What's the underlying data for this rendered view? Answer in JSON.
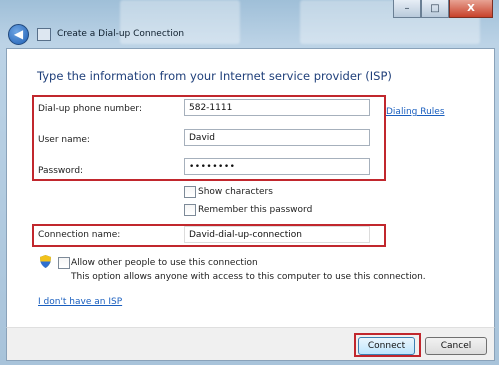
{
  "window": {
    "title": "Create a Dial-up Connection",
    "controls": {
      "minimize": "–",
      "maximize": "□",
      "close": "X"
    }
  },
  "page": {
    "heading": "Type the information from your Internet service provider (ISP)",
    "phone": {
      "label": "Dial-up phone number:",
      "value": "582-1111"
    },
    "dialing_rules": "Dialing Rules",
    "username": {
      "label": "User name:",
      "value": "David"
    },
    "password": {
      "label": "Password:",
      "value": "••••••••"
    },
    "show_characters": {
      "label": "Show characters",
      "checked": false
    },
    "remember_password": {
      "label": "Remember this password",
      "checked": false
    },
    "connection_name": {
      "label": "Connection name:",
      "value": "David-dial-up-connection"
    },
    "allow_others": {
      "label": "Allow other people to use this connection",
      "description": "This option allows anyone with access to this computer to use this connection.",
      "checked": false
    },
    "no_isp_link": "I don't have an ISP"
  },
  "footer": {
    "connect": "Connect",
    "cancel": "Cancel"
  },
  "colors": {
    "highlight": "#c1272d",
    "heading": "#1f3f7a",
    "link": "#1a5fbf"
  },
  "icons": {
    "back": "back-arrow-icon",
    "window": "dialup-window-icon",
    "uac": "uac-shield-icon"
  }
}
